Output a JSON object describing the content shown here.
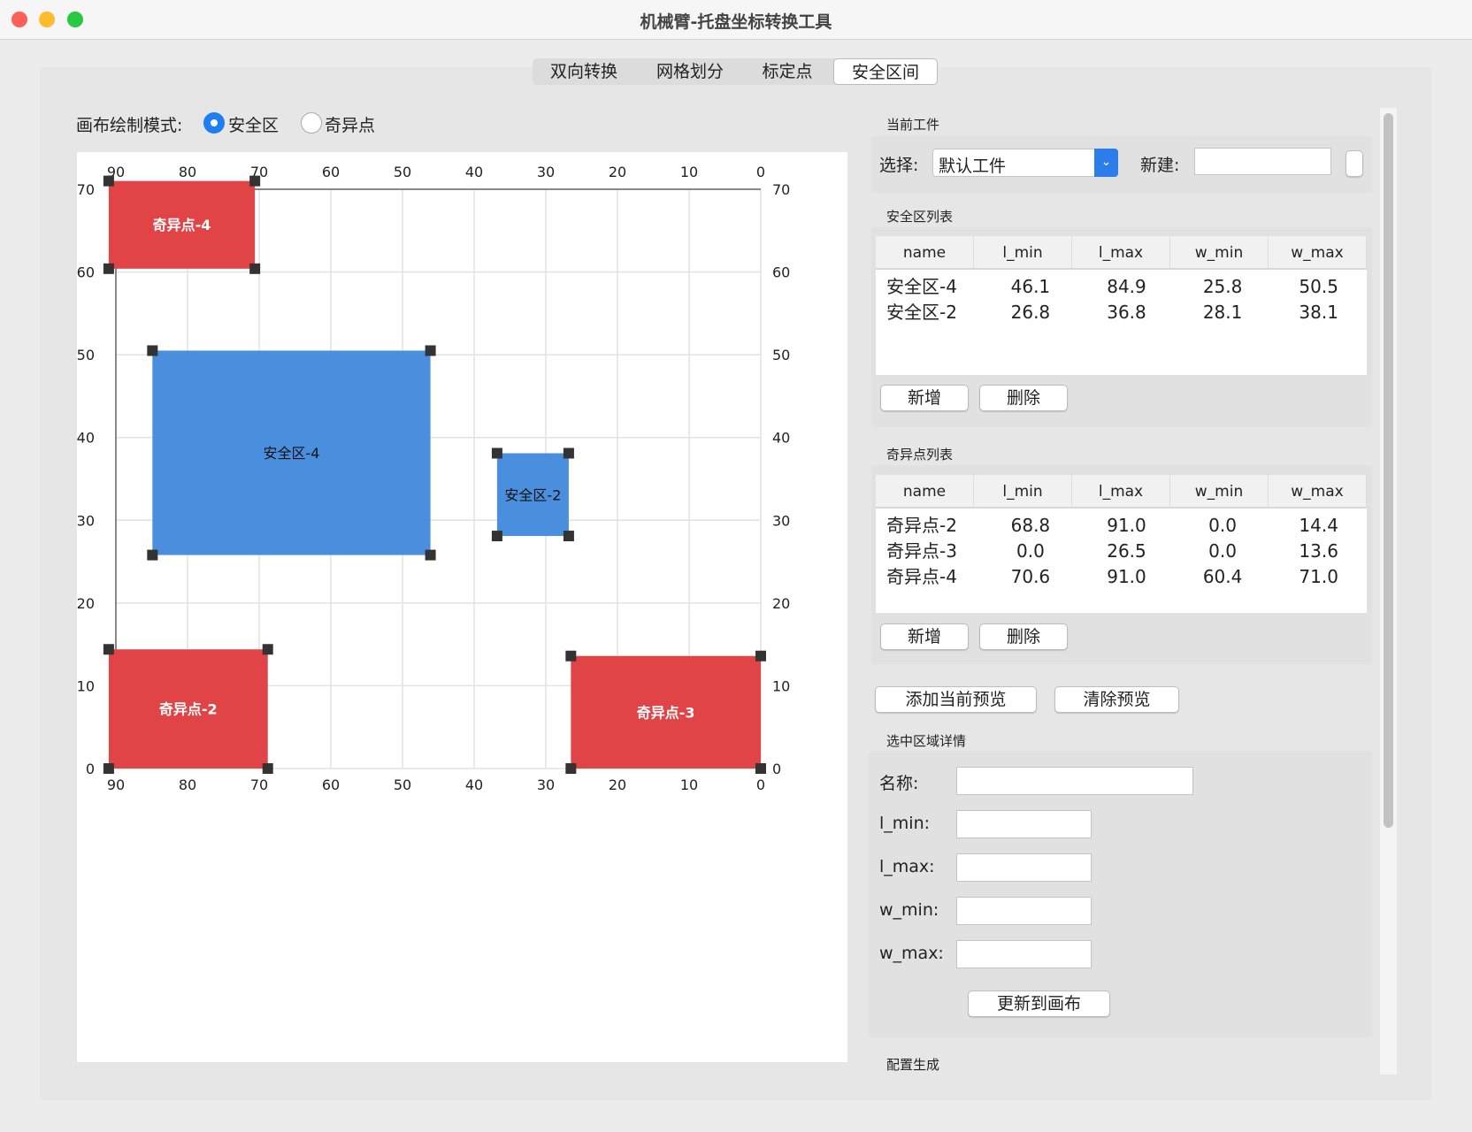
{
  "window": {
    "title": "机械臂-托盘坐标转换工具"
  },
  "tabs": [
    {
      "label": "双向转换"
    },
    {
      "label": "网格划分"
    },
    {
      "label": "标定点"
    },
    {
      "label": "安全区间",
      "selected": true
    }
  ],
  "mode": {
    "label": "画布绘制模式:",
    "options": [
      {
        "label": "安全区",
        "checked": true
      },
      {
        "label": "奇异点",
        "checked": false
      }
    ]
  },
  "workpiece": {
    "title": "当前工件",
    "select_label": "选择:",
    "selected": "默认工件",
    "new_label": "新建:",
    "new_value": ""
  },
  "safe_list": {
    "title": "安全区列表",
    "columns": [
      "name",
      "l_min",
      "l_max",
      "w_min",
      "w_max"
    ],
    "rows": [
      [
        "安全区-4",
        "46.1",
        "84.9",
        "25.8",
        "50.5"
      ],
      [
        "安全区-2",
        "26.8",
        "36.8",
        "28.1",
        "38.1"
      ]
    ],
    "add": "新增",
    "delete": "删除"
  },
  "sing_list": {
    "title": "奇异点列表",
    "columns": [
      "name",
      "l_min",
      "l_max",
      "w_min",
      "w_max"
    ],
    "rows": [
      [
        "奇异点-2",
        "68.8",
        "91.0",
        "0.0",
        "14.4"
      ],
      [
        "奇异点-3",
        "0.0",
        "26.5",
        "0.0",
        "13.6"
      ],
      [
        "奇异点-4",
        "70.6",
        "91.0",
        "60.4",
        "71.0"
      ]
    ],
    "add": "新增",
    "delete": "删除"
  },
  "preview": {
    "add": "添加当前预览",
    "clear": "清除预览"
  },
  "details": {
    "title": "选中区域详情",
    "name_label": "名称:",
    "lmin_label": "l_min:",
    "lmax_label": "l_max:",
    "wmin_label": "w_min:",
    "wmax_label": "w_max:",
    "update": "更新到画布"
  },
  "config": {
    "title": "配置生成"
  },
  "chart_data": {
    "type": "rect-regions",
    "x_field": "l",
    "y_field": "w",
    "xlim": [
      90,
      0
    ],
    "ylim": [
      0,
      70
    ],
    "xticks": [
      "90",
      "80",
      "70",
      "60",
      "50",
      "40",
      "30",
      "20",
      "10",
      "0"
    ],
    "yticks": [
      "70",
      "60",
      "50",
      "40",
      "30",
      "20",
      "10",
      "0"
    ],
    "grid": true,
    "colors": {
      "safe": "#4a8ede",
      "singular": "#e04446",
      "handle": "#333333"
    },
    "regions": [
      {
        "name": "安全区-4",
        "kind": "safe",
        "l_min": 46.1,
        "l_max": 84.9,
        "w_min": 25.8,
        "w_max": 50.5
      },
      {
        "name": "安全区-2",
        "kind": "safe",
        "l_min": 26.8,
        "l_max": 36.8,
        "w_min": 28.1,
        "w_max": 38.1
      },
      {
        "name": "奇异点-2",
        "kind": "singular",
        "l_min": 68.8,
        "l_max": 91.0,
        "w_min": 0.0,
        "w_max": 14.4
      },
      {
        "name": "奇异点-3",
        "kind": "singular",
        "l_min": 0.0,
        "l_max": 26.5,
        "w_min": 0.0,
        "w_max": 13.6
      },
      {
        "name": "奇异点-4",
        "kind": "singular",
        "l_min": 70.6,
        "l_max": 91.0,
        "w_min": 60.4,
        "w_max": 71.0
      }
    ]
  }
}
